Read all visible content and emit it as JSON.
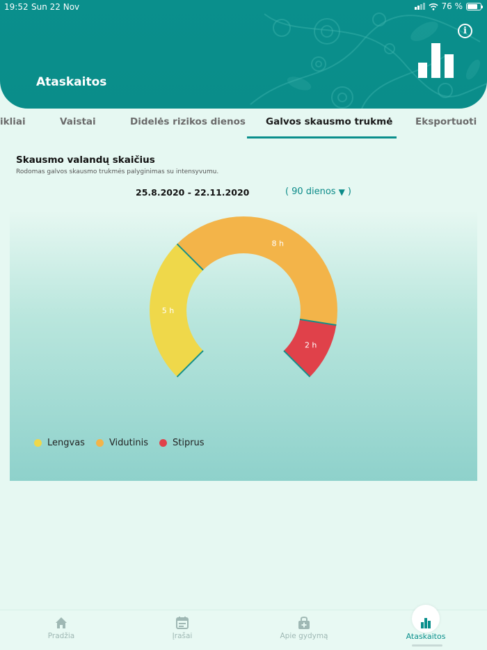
{
  "status_bar": {
    "time": "19:52",
    "date": "Sun 22 Nov",
    "battery": "76 %"
  },
  "header": {
    "title": "Ataskaitos"
  },
  "tabs": [
    {
      "label": "ikliai",
      "active": false
    },
    {
      "label": "Vaistai",
      "active": false
    },
    {
      "label": "Didelės rizikos dienos",
      "active": false
    },
    {
      "label": "Galvos skausmo trukmė",
      "active": true
    },
    {
      "label": "Eksportuoti",
      "active": false
    }
  ],
  "report": {
    "title": "Skausmo valandų skaičius",
    "subtitle": "Rodomas galvos skausmo trukmės palyginimas su intensyvumu.",
    "date_range": "25.8.2020 - 22.11.2020",
    "period": "90 dienos"
  },
  "chart_data": {
    "type": "pie",
    "variant": "arc-donut",
    "categories": [
      "Lengvas",
      "Vidutinis",
      "Stiprus"
    ],
    "values": [
      5,
      8,
      2
    ],
    "unit": "h",
    "value_labels": [
      "5 h",
      "8 h",
      "2 h"
    ],
    "colors": [
      "#efd84a",
      "#f3b449",
      "#e0414a"
    ],
    "legend_placement": "bottom-left"
  },
  "legend": [
    {
      "label": "Lengvas",
      "color": "#efd84a"
    },
    {
      "label": "Vidutinis",
      "color": "#f3b449"
    },
    {
      "label": "Stiprus",
      "color": "#e0414a"
    }
  ],
  "bottom_nav": [
    {
      "label": "Pradžia",
      "icon": "home-icon",
      "active": false
    },
    {
      "label": "Įrašai",
      "icon": "calendar-icon",
      "active": false
    },
    {
      "label": "Apie gydymą",
      "icon": "medical-bag-icon",
      "active": false
    },
    {
      "label": "Ataskaitos",
      "icon": "bar-chart-icon",
      "active": true
    }
  ],
  "colors": {
    "accent": "#0a8f8c",
    "background": "#e6f8f2"
  }
}
